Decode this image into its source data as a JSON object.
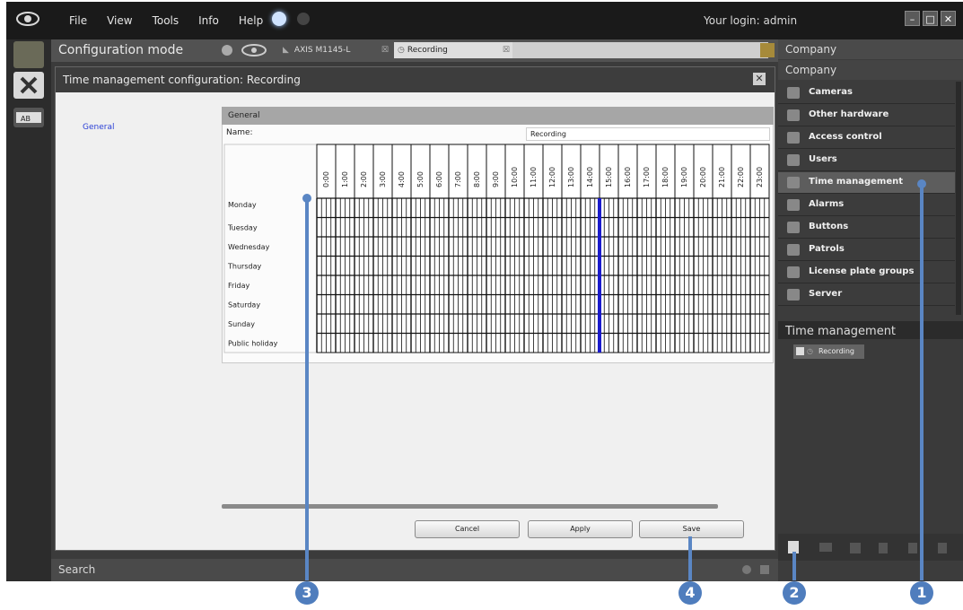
{
  "menubar": {
    "items": [
      "File",
      "View",
      "Tools",
      "Info",
      "Help"
    ],
    "login_text": "Your login: admin"
  },
  "mode": {
    "title": "Configuration mode",
    "tabs": [
      {
        "label": "AXIS M1145-L"
      },
      {
        "label": "Recording"
      }
    ]
  },
  "dialog": {
    "title": "Time management configuration: Recording",
    "nav": {
      "general": "General"
    },
    "section_title": "General",
    "name_label": "Name:",
    "name_value": "Recording",
    "hours": [
      "0:00",
      "1:00",
      "2:00",
      "3:00",
      "4:00",
      "5:00",
      "6:00",
      "7:00",
      "8:00",
      "9:00",
      "10:00",
      "11:00",
      "12:00",
      "13:00",
      "14:00",
      "15:00",
      "16:00",
      "17:00",
      "18:00",
      "19:00",
      "20:00",
      "21:00",
      "22:00",
      "23:00"
    ],
    "days": [
      "Monday",
      "Tuesday",
      "Wednesday",
      "Thursday",
      "Friday",
      "Saturday",
      "Sunday",
      "Public holiday"
    ],
    "current_hour_marker": 15,
    "buttons": {
      "cancel": "Cancel",
      "apply": "Apply",
      "save": "Save"
    }
  },
  "search": {
    "label": "Search"
  },
  "right_panel": {
    "header_top": "Company",
    "header": "Company",
    "items": [
      {
        "label": "Cameras",
        "icon": "camera-icon"
      },
      {
        "label": "Other hardware",
        "icon": "hardware-icon"
      },
      {
        "label": "Access control",
        "icon": "access-control-icon"
      },
      {
        "label": "Users",
        "icon": "user-icon"
      },
      {
        "label": "Time management",
        "icon": "clock-icon"
      },
      {
        "label": "Alarms",
        "icon": "alarm-icon"
      },
      {
        "label": "Buttons",
        "icon": "button-icon"
      },
      {
        "label": "Patrols",
        "icon": "patrol-icon"
      },
      {
        "label": "License plate groups",
        "icon": "license-plate-icon"
      },
      {
        "label": "Server",
        "icon": "server-icon"
      }
    ],
    "selected_index": 4,
    "time_management": {
      "header": "Time management",
      "item": "Recording"
    }
  },
  "callouts": [
    "1",
    "2",
    "3",
    "4"
  ],
  "colors": {
    "accent_blue": "#1a1acc",
    "callout_blue": "#4f7dbd"
  }
}
